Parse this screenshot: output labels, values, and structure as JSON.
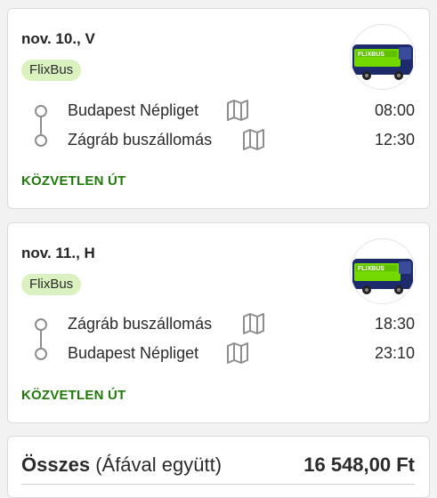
{
  "trips": [
    {
      "date": "nov. 10., V",
      "operator": "FlixBus",
      "from": "Budapest Népliget",
      "from_time": "08:00",
      "to": "Zágráb buszállomás",
      "to_time": "12:30",
      "direct_label": "KÖZVETLEN ÚT"
    },
    {
      "date": "nov. 11., H",
      "operator": "FlixBus",
      "from": "Zágráb buszállomás",
      "from_time": "18:30",
      "to": "Budapest Népliget",
      "to_time": "23:10",
      "direct_label": "KÖZVETLEN ÚT"
    }
  ],
  "summary": {
    "total_label": "Összes",
    "vat_note": "(Áfával együtt)",
    "price": "16 548,00 Ft"
  },
  "logo_text": "FLIXBUS",
  "colors": {
    "accent_green": "#1f7a0a",
    "badge_bg": "#d9f2c0",
    "flix_green": "#73d700",
    "bus_navy": "#1d2a6b"
  }
}
